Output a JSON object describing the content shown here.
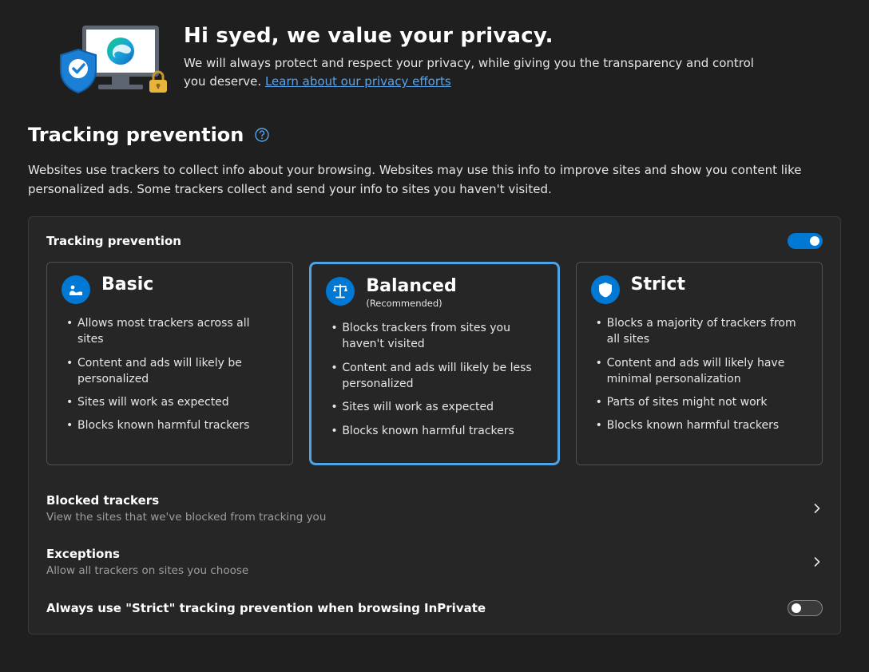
{
  "hero": {
    "title": "Hi syed, we value your privacy.",
    "desc_a": "We will always protect and respect your privacy, while giving you the transparency and control you deserve. ",
    "link": "Learn about our privacy efforts"
  },
  "section": {
    "title": "Tracking prevention",
    "desc": "Websites use trackers to collect info about your browsing. Websites may use this info to improve sites and show you content like personalized ads. Some trackers collect and send your info to sites you haven't visited."
  },
  "panel": {
    "title": "Tracking prevention"
  },
  "cards": {
    "basic": {
      "title": "Basic",
      "b0": "Allows most trackers across all sites",
      "b1": "Content and ads will likely be personalized",
      "b2": "Sites will work as expected",
      "b3": "Blocks known harmful trackers"
    },
    "balanced": {
      "title": "Balanced",
      "sub": "(Recommended)",
      "b0": "Blocks trackers from sites you haven't visited",
      "b1": "Content and ads will likely be less personalized",
      "b2": "Sites will work as expected",
      "b3": "Blocks known harmful trackers"
    },
    "strict": {
      "title": "Strict",
      "b0": "Blocks a majority of trackers from all sites",
      "b1": "Content and ads will likely have minimal personalization",
      "b2": "Parts of sites might not work",
      "b3": "Blocks known harmful trackers"
    }
  },
  "rows": {
    "blocked": {
      "title": "Blocked trackers",
      "desc": "View the sites that we've blocked from tracking you"
    },
    "exceptions": {
      "title": "Exceptions",
      "desc": "Allow all trackers on sites you choose"
    },
    "inprivate": {
      "title": "Always use \"Strict\" tracking prevention when browsing InPrivate"
    }
  }
}
